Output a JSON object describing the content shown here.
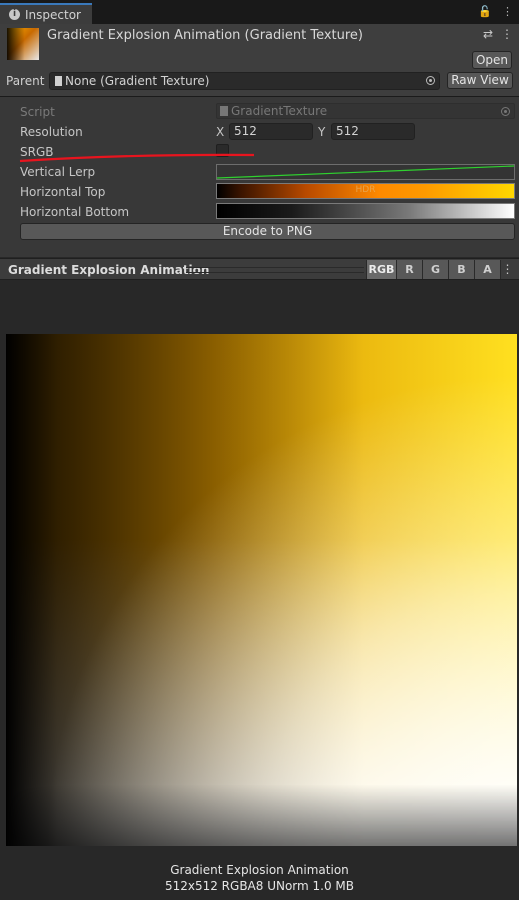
{
  "tab": {
    "label": "Inspector"
  },
  "header": {
    "title": "Gradient Explosion Animation (Gradient Texture)",
    "open_label": "Open",
    "parent_label": "Parent",
    "parent_value": "None (Gradient Texture)",
    "raw_view_label": "Raw View"
  },
  "properties": {
    "script_label": "Script",
    "script_value": "GradientTexture",
    "resolution_label": "Resolution",
    "x_label": "X",
    "x_value": "512",
    "y_label": "Y",
    "y_value": "512",
    "srgb_label": "SRGB",
    "srgb_checked": false,
    "vertical_lerp_label": "Vertical Lerp",
    "horizontal_top_label": "Horizontal Top",
    "hdr_tag": "HDR",
    "horizontal_bottom_label": "Horizontal Bottom",
    "encode_label": "Encode to PNG"
  },
  "preview": {
    "title": "Gradient Explosion Animation",
    "channels": [
      "RGB",
      "R",
      "G",
      "B",
      "A"
    ],
    "active_channel": "RGB",
    "caption_name": "Gradient Explosion Animation",
    "caption_info": "512x512  RGBA8 UNorm   1.0 MB"
  },
  "colors": {
    "accent_tab": "#3a79bb",
    "annotation_red": "#e8141e",
    "curve_green": "#2fd12f"
  }
}
